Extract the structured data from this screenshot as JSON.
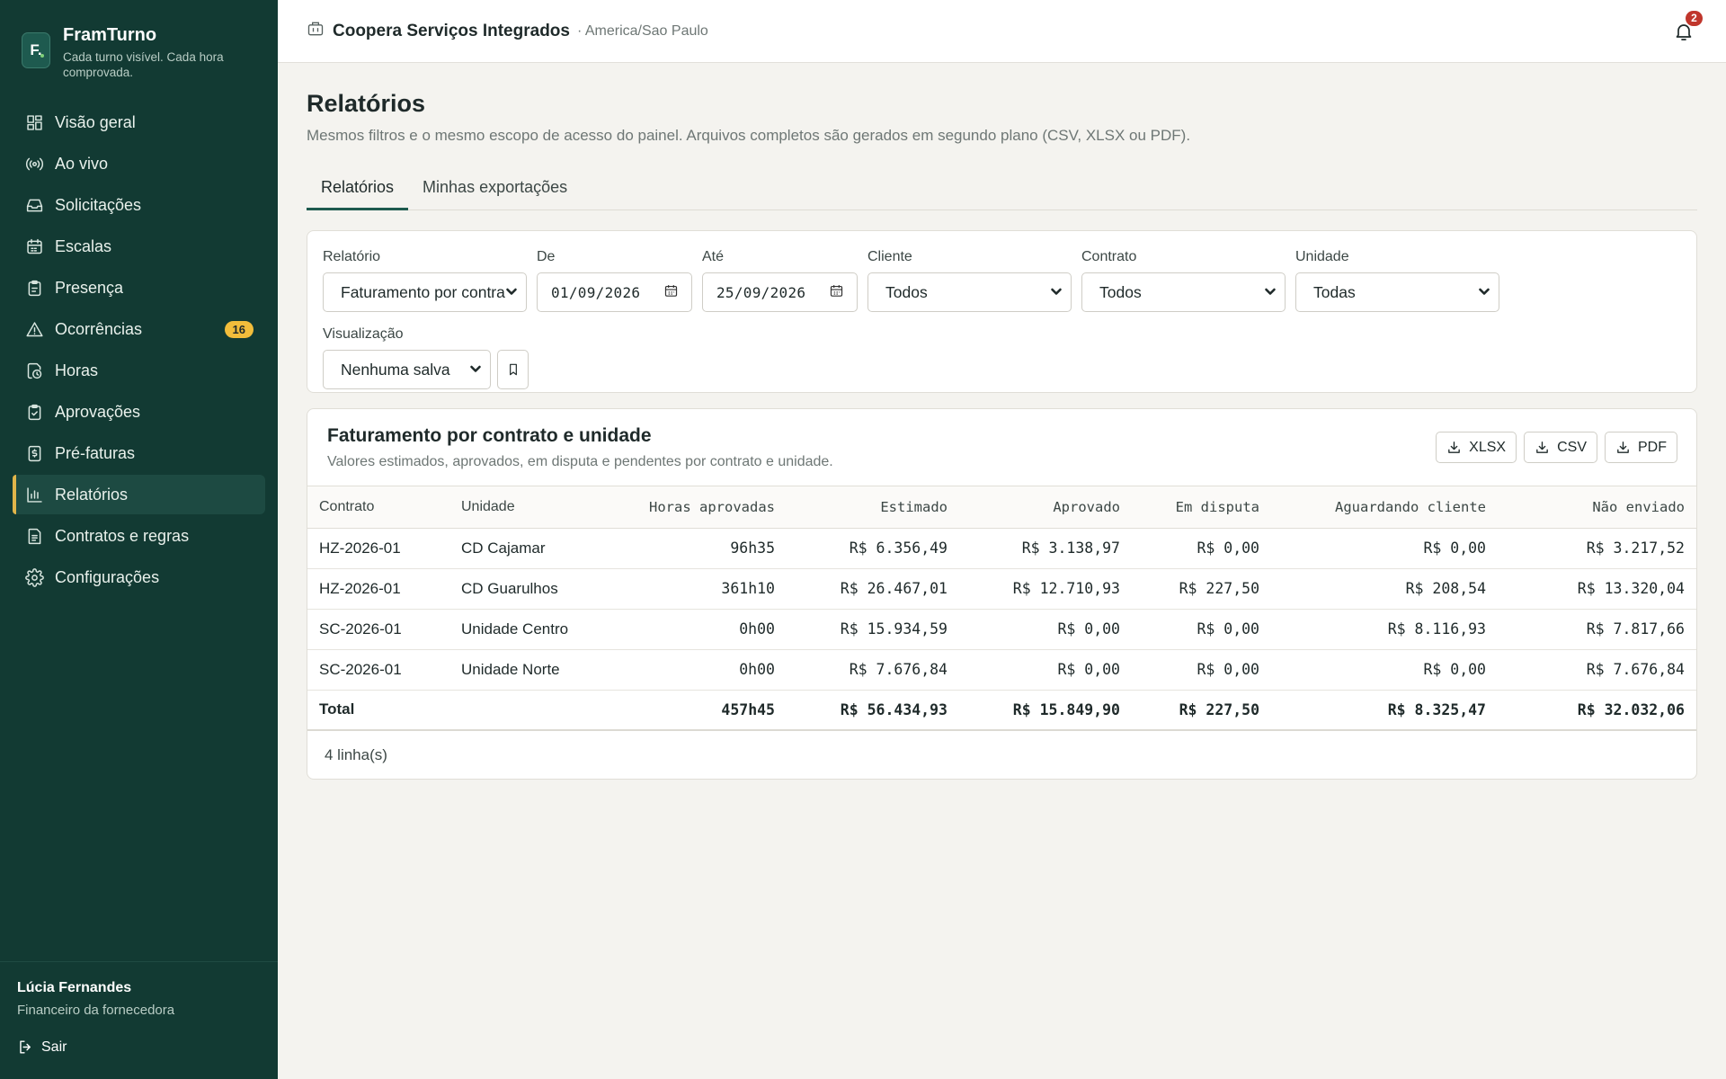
{
  "brand": {
    "logo": "F.",
    "name": "FramTurno",
    "tagline": "Cada turno visível. Cada hora comprovada."
  },
  "nav": [
    {
      "label": "Visão geral",
      "icon": "grid-icon"
    },
    {
      "label": "Ao vivo",
      "icon": "broadcast-icon"
    },
    {
      "label": "Solicitações",
      "icon": "inbox-icon"
    },
    {
      "label": "Escalas",
      "icon": "calendar-icon"
    },
    {
      "label": "Presença",
      "icon": "clipboard-icon"
    },
    {
      "label": "Ocorrências",
      "icon": "alert-icon",
      "badge": "16"
    },
    {
      "label": "Horas",
      "icon": "clock-file-icon"
    },
    {
      "label": "Aprovações",
      "icon": "clipboard-check-icon"
    },
    {
      "label": "Pré-faturas",
      "icon": "invoice-icon"
    },
    {
      "label": "Relatórios",
      "icon": "bar-chart-icon",
      "active": true
    },
    {
      "label": "Contratos e regras",
      "icon": "document-icon"
    },
    {
      "label": "Configurações",
      "icon": "gear-icon"
    }
  ],
  "user": {
    "name": "Lúcia Fernandes",
    "role": "Financeiro da fornecedora",
    "logout": "Sair"
  },
  "topbar": {
    "org": "Coopera Serviços Integrados",
    "timezone": "· America/Sao Paulo",
    "notifications": "2"
  },
  "page": {
    "title": "Relatórios",
    "subtitle": "Mesmos filtros e o mesmo escopo de acesso do painel. Arquivos completos são gerados em segundo plano (CSV, XLSX ou PDF).",
    "tabs": [
      "Relatórios",
      "Minhas exportações"
    ]
  },
  "filters": {
    "relatorio": {
      "label": "Relatório",
      "value": "Faturamento por contrato e unidade"
    },
    "de": {
      "label": "De",
      "value": "01/09/2026"
    },
    "ate": {
      "label": "Até",
      "value": "25/09/2026"
    },
    "cliente": {
      "label": "Cliente",
      "value": "Todos"
    },
    "contrato": {
      "label": "Contrato",
      "value": "Todos"
    },
    "unidade": {
      "label": "Unidade",
      "value": "Todas"
    },
    "visualizacao": {
      "label": "Visualização",
      "value": "Nenhuma salva"
    }
  },
  "report": {
    "title": "Faturamento por contrato e unidade",
    "subtitle": "Valores estimados, aprovados, em disputa e pendentes por contrato e unidade.",
    "exports": [
      "XLSX",
      "CSV",
      "PDF"
    ],
    "columns": [
      "Contrato",
      "Unidade",
      "Horas aprovadas",
      "Estimado",
      "Aprovado",
      "Em disputa",
      "Aguardando cliente",
      "Não enviado"
    ],
    "rows": [
      [
        "HZ-2026-01",
        "CD Cajamar",
        "96h35",
        "R$ 6.356,49",
        "R$ 3.138,97",
        "R$ 0,00",
        "R$ 0,00",
        "R$ 3.217,52"
      ],
      [
        "HZ-2026-01",
        "CD Guarulhos",
        "361h10",
        "R$ 26.467,01",
        "R$ 12.710,93",
        "R$ 227,50",
        "R$ 208,54",
        "R$ 13.320,04"
      ],
      [
        "SC-2026-01",
        "Unidade Centro",
        "0h00",
        "R$ 15.934,59",
        "R$ 0,00",
        "R$ 0,00",
        "R$ 8.116,93",
        "R$ 7.817,66"
      ],
      [
        "SC-2026-01",
        "Unidade Norte",
        "0h00",
        "R$ 7.676,84",
        "R$ 0,00",
        "R$ 0,00",
        "R$ 0,00",
        "R$ 7.676,84"
      ]
    ],
    "total": [
      "Total",
      "",
      "457h45",
      "R$ 56.434,93",
      "R$ 15.849,90",
      "R$ 227,50",
      "R$ 8.325,47",
      "R$ 32.032,06"
    ],
    "footer": "4 linha(s)"
  }
}
